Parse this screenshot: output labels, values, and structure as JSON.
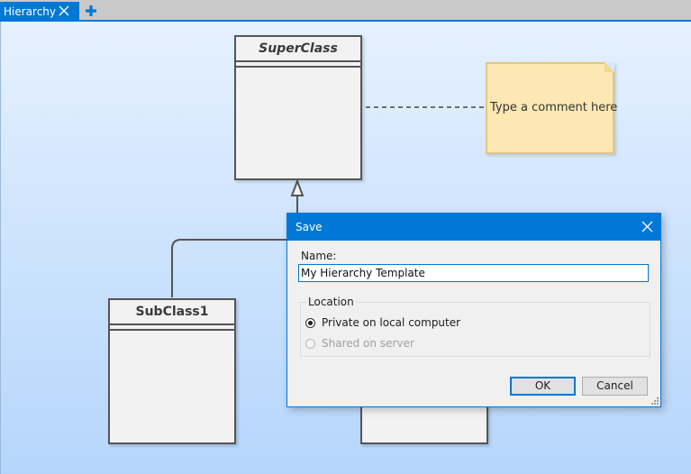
{
  "tab": {
    "label": "Hierarchy",
    "close_icon": "close-icon",
    "add_icon": "plus-icon"
  },
  "diagram": {
    "superclass": {
      "name": "SuperClass"
    },
    "subclass1": {
      "name": "SubClass1"
    },
    "note": {
      "text": "Type a comment here"
    }
  },
  "dialog": {
    "title": "Save",
    "name_label": "Name:",
    "name_value": "My Hierarchy Template",
    "location_label": "Location",
    "option_private": "Private on local computer",
    "option_shared": "Shared on server",
    "selected_option": "private",
    "ok_label": "OK",
    "cancel_label": "Cancel"
  },
  "colors": {
    "accent": "#0078d7",
    "note_fill": "#fde8b3",
    "class_fill": "#f2f2f2"
  }
}
